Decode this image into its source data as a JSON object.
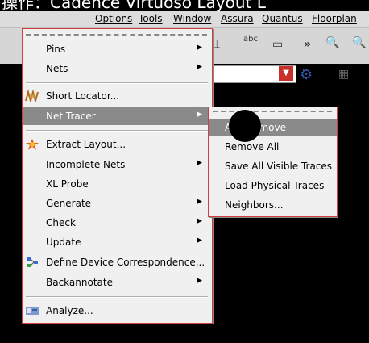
{
  "title": "操作：Cadence Virtuoso Layout L",
  "menubar": {
    "items": [
      "Options",
      "Tools",
      "Window",
      "Assura",
      "Quantus",
      "Floorplan"
    ]
  },
  "toolbar": {
    "abc_label": "abc",
    "more_label": "»"
  },
  "menu": {
    "items": [
      {
        "label": "Pins",
        "submenu": true
      },
      {
        "label": "Nets",
        "submenu": true
      },
      {
        "label": "Short Locator...",
        "icon": "short-locator-icon"
      },
      {
        "label": "Net Tracer",
        "submenu": true,
        "highlighted": true
      },
      {
        "label": "Extract Layout...",
        "icon": "extract-layout-icon"
      },
      {
        "label": "Incomplete Nets",
        "submenu": true
      },
      {
        "label": "XL Probe"
      },
      {
        "label": "Generate",
        "submenu": true
      },
      {
        "label": "Check",
        "submenu": true
      },
      {
        "label": "Update",
        "submenu": true
      },
      {
        "label": "Define Device Correspondence...",
        "icon": "device-correspondence-icon"
      },
      {
        "label": "Backannotate",
        "submenu": true
      },
      {
        "label": "Analyze...",
        "icon": "analyze-icon"
      }
    ]
  },
  "submenu": {
    "items": [
      {
        "label": "Add/Remove",
        "highlighted": true
      },
      {
        "label": "Remove All"
      },
      {
        "label": "Save All Visible Traces"
      },
      {
        "label": "Load Physical Traces"
      },
      {
        "label": "Neighbors..."
      }
    ]
  }
}
